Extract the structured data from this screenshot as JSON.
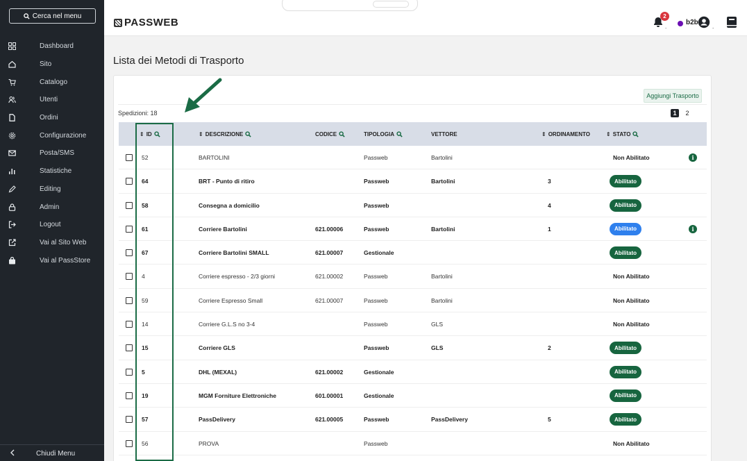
{
  "sidebar": {
    "search_label": "Cerca nel menu",
    "items": [
      {
        "label": "Dashboard",
        "icon": "dashboard-icon"
      },
      {
        "label": "Sito",
        "icon": "home-icon"
      },
      {
        "label": "Catalogo",
        "icon": "cart-icon"
      },
      {
        "label": "Utenti",
        "icon": "users-icon"
      },
      {
        "label": "Ordini",
        "icon": "document-icon"
      },
      {
        "label": "Configurazione",
        "icon": "gear-icon"
      },
      {
        "label": "Posta/SMS",
        "icon": "mail-icon"
      },
      {
        "label": "Statistiche",
        "icon": "chart-icon"
      },
      {
        "label": "Editing",
        "icon": "pencil-icon"
      },
      {
        "label": "Admin",
        "icon": "lock-icon"
      },
      {
        "label": "Logout",
        "icon": "logout-icon"
      },
      {
        "label": "Vai al Sito Web",
        "icon": "external-link-icon"
      },
      {
        "label": "Vai al PassStore",
        "icon": "bag-icon"
      }
    ],
    "footer_label": "Chiudi Menu"
  },
  "header": {
    "logo": "PASSWEB",
    "notifications_count": "2",
    "user_name": "b2b"
  },
  "page": {
    "title": "Lista dei Metodi di Trasporto",
    "add_button": "Aggiungi Trasporto",
    "count_label": "Spedizioni: 18",
    "pages": [
      "1",
      "2"
    ]
  },
  "table": {
    "columns": {
      "id": "ID",
      "descrizione": "DESCRIZIONE",
      "codice": "CODICE",
      "tipologia": "TIPOLOGIA",
      "vettore": "VETTORE",
      "ordinamento": "ORDINAMENTO",
      "stato": "STATO"
    },
    "rows": [
      {
        "id": "52",
        "descrizione": "BARTOLINI",
        "codice": "",
        "tipologia": "Passweb",
        "vettore": "Bartolini",
        "ordinamento": "",
        "stato": "Non Abilitato"
      },
      {
        "id": "64",
        "descrizione": "BRT - Punto di ritiro",
        "codice": "",
        "tipologia": "Passweb",
        "vettore": "Bartolini",
        "ordinamento": "3",
        "stato": "Abilitato"
      },
      {
        "id": "58",
        "descrizione": "Consegna a domicilio",
        "codice": "",
        "tipologia": "Passweb",
        "vettore": "",
        "ordinamento": "4",
        "stato": "Abilitato"
      },
      {
        "id": "61",
        "descrizione": "Corriere Bartolini",
        "codice": "621.00006",
        "tipologia": "Passweb",
        "vettore": "Bartolini",
        "ordinamento": "1",
        "stato": "Abilitato"
      },
      {
        "id": "67",
        "descrizione": "Corriere Bartolini SMALL",
        "codice": "621.00007",
        "tipologia": "Gestionale",
        "vettore": "",
        "ordinamento": "",
        "stato": "Abilitato"
      },
      {
        "id": "4",
        "descrizione": "Corriere espresso - 2/3 giorni",
        "codice": "621.00002",
        "tipologia": "Passweb",
        "vettore": "Bartolini",
        "ordinamento": "",
        "stato": "Non Abilitato"
      },
      {
        "id": "59",
        "descrizione": "Corriere Espresso Small",
        "codice": "621.00007",
        "tipologia": "Passweb",
        "vettore": "Bartolini",
        "ordinamento": "",
        "stato": "Non Abilitato"
      },
      {
        "id": "14",
        "descrizione": "Corriere G.L.S no 3-4",
        "codice": "",
        "tipologia": "Passweb",
        "vettore": "GLS",
        "ordinamento": "",
        "stato": "Non Abilitato"
      },
      {
        "id": "15",
        "descrizione": "Corriere GLS",
        "codice": "",
        "tipologia": "Passweb",
        "vettore": "GLS",
        "ordinamento": "2",
        "stato": "Abilitato"
      },
      {
        "id": "5",
        "descrizione": "DHL (MEXAL)",
        "codice": "621.00002",
        "tipologia": "Gestionale",
        "vettore": "",
        "ordinamento": "",
        "stato": "Abilitato"
      },
      {
        "id": "19",
        "descrizione": "MGM Forniture Elettroniche",
        "codice": "601.00001",
        "tipologia": "Gestionale",
        "vettore": "",
        "ordinamento": "",
        "stato": "Abilitato"
      },
      {
        "id": "57",
        "descrizione": "PassDelivery",
        "codice": "621.00005",
        "tipologia": "Passweb",
        "vettore": "PassDelivery",
        "ordinamento": "5",
        "stato": "Abilitato"
      },
      {
        "id": "56",
        "descrizione": "PROVA",
        "codice": "",
        "tipologia": "Passweb",
        "vettore": "",
        "ordinamento": "",
        "stato": "Non Abilitato"
      }
    ]
  },
  "colors": {
    "sidebar_bg": "#20252b",
    "accent_green": "#17653f",
    "accent_blue": "#2f80ed",
    "header_row_bg": "#d8dde7",
    "notification_red": "#d9363e"
  }
}
